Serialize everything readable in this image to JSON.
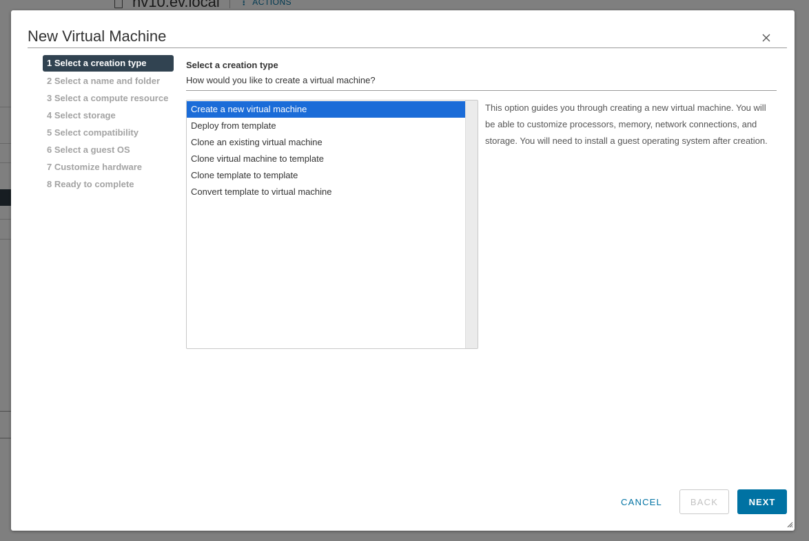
{
  "background": {
    "host_name": "hv10.ev.local",
    "actions_label": "ACTIONS"
  },
  "dialog": {
    "title": "New Virtual Machine"
  },
  "steps": [
    {
      "label": "1 Select a creation type",
      "active": true
    },
    {
      "label": "2 Select a name and folder",
      "active": false
    },
    {
      "label": "3 Select a compute resource",
      "active": false
    },
    {
      "label": "4 Select storage",
      "active": false
    },
    {
      "label": "5 Select compatibility",
      "active": false
    },
    {
      "label": "6 Select a guest OS",
      "active": false
    },
    {
      "label": "7 Customize hardware",
      "active": false
    },
    {
      "label": "8 Ready to complete",
      "active": false
    }
  ],
  "content": {
    "title": "Select a creation type",
    "subtitle": "How would you like to create a virtual machine?",
    "options": [
      {
        "label": "Create a new virtual machine",
        "selected": true
      },
      {
        "label": "Deploy from template",
        "selected": false
      },
      {
        "label": "Clone an existing virtual machine",
        "selected": false
      },
      {
        "label": "Clone virtual machine to template",
        "selected": false
      },
      {
        "label": "Clone template to template",
        "selected": false
      },
      {
        "label": "Convert template to virtual machine",
        "selected": false
      }
    ],
    "description": "This option guides you through creating a new virtual machine. You will be able to customize processors, memory, network connections, and storage. You will need to install a guest operating system after creation."
  },
  "footer": {
    "cancel_label": "CANCEL",
    "back_label": "BACK",
    "next_label": "NEXT"
  },
  "icons": {
    "close": "close-icon",
    "host": "host-icon",
    "resize": "resize-grip-icon"
  },
  "colors": {
    "active_step_bg": "#314351",
    "selected_item_bg": "#1b6cd8",
    "primary_button": "#0072a3"
  }
}
